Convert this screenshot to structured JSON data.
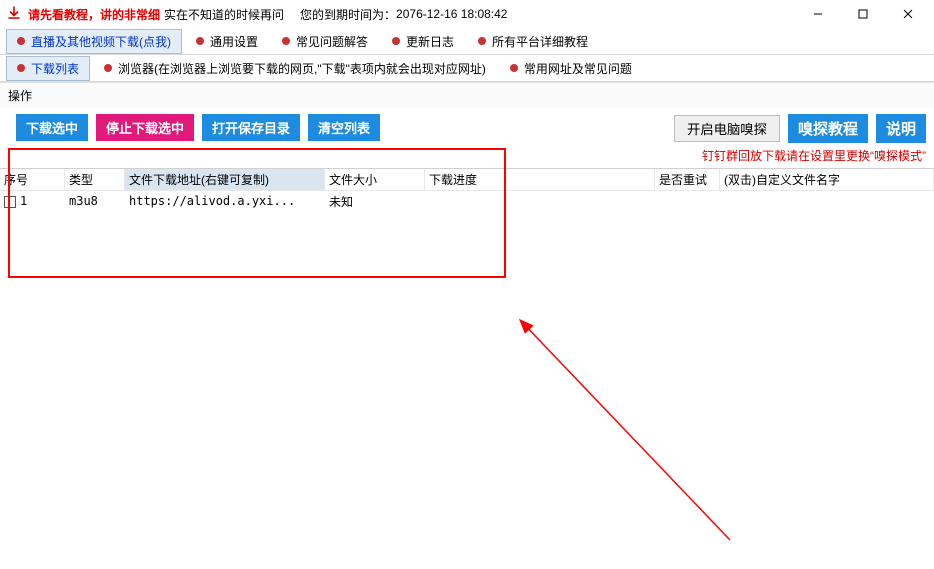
{
  "titlebar": {
    "text_red": "请先看教程，讲的非常细",
    "text_black": "实在不知道的时候再问",
    "expire_label": "您的到期时间为：",
    "expire_value": "2076-12-16 18:08:42"
  },
  "tabs_main": [
    {
      "label": "直播及其他视频下载(点我)",
      "active": true
    },
    {
      "label": "通用设置",
      "active": false
    },
    {
      "label": "常见问题解答",
      "active": false
    },
    {
      "label": "更新日志",
      "active": false
    },
    {
      "label": "所有平台详细教程",
      "active": false
    }
  ],
  "tabs_sub": [
    {
      "label": "下载列表",
      "active": true
    },
    {
      "label": "浏览器(在浏览器上浏览要下载的网页,\"下载\"表项内就会出现对应网址)",
      "active": false
    },
    {
      "label": "常用网址及常见问题",
      "active": false
    }
  ],
  "section_label": "操作",
  "actions": {
    "download_selected": "下载选中",
    "stop_selected": "停止下载选中",
    "open_dir": "打开保存目录",
    "clear_list": "清空列表",
    "enable_sniffer": "开启电脑嗅探",
    "sniffer_tutorial": "嗅探教程",
    "instructions": "说明",
    "tip_red": "钉钉群回放下载请在设置里更换“嗅探模式”"
  },
  "table": {
    "headers": {
      "idx": "序号",
      "type": "类型",
      "url": "文件下载地址(右键可复制)",
      "size": "文件大小",
      "progress": "下载进度",
      "retry": "是否重试",
      "rename": "(双击)自定义文件名字"
    },
    "rows": [
      {
        "idx": "1",
        "type": "m3u8",
        "url": "https://alivod.a.yxi...",
        "size": "未知",
        "progress": "",
        "retry": "",
        "rename": ""
      }
    ]
  }
}
